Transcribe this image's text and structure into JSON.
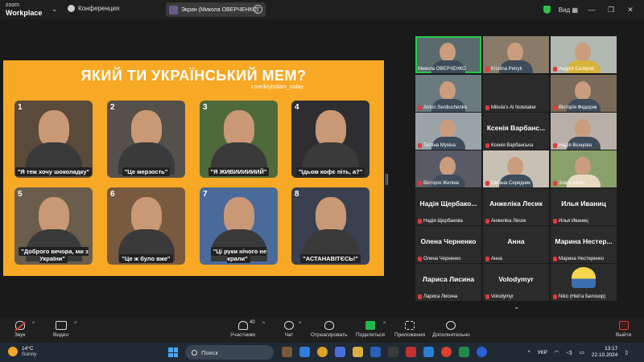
{
  "topbar": {
    "brand_top": "zoom",
    "brand_bottom": "Workplace",
    "meeting_title": "Конференция",
    "share_label": "Экран (Микола ОВЕРЧЕНКО)",
    "view_label": "Вид"
  },
  "shared_screen": {
    "title": "ЯКИЙ ТИ УКРАЇНСЬКИЙ МЕМ?",
    "link": "t.me/kryholam_today",
    "cards": [
      {
        "num": "1",
        "caption": "\"Я теж хочу шоколадку\""
      },
      {
        "num": "2",
        "caption": "\"Це мерзость\""
      },
      {
        "num": "3",
        "caption": "\"Я ЖИВИИИИИИЙ\""
      },
      {
        "num": "4",
        "caption": "\"Ідьом кофє піть, а?\""
      },
      {
        "num": "5",
        "caption": "\"Доброго вечора, ми з України\""
      },
      {
        "num": "6",
        "caption": "\"Це ж було вже\""
      },
      {
        "num": "7",
        "caption": "\"Ці руки нічого не крали\""
      },
      {
        "num": "8",
        "caption": "\"АСТАНАВІТЄСЬ!\""
      }
    ]
  },
  "gallery": {
    "tiles": [
      {
        "name": "Микола ОВЕРЧЕНКО",
        "big": ""
      },
      {
        "name": "Kristina Petryk",
        "big": ""
      },
      {
        "name": "Андрій Скляров",
        "big": ""
      },
      {
        "name": "Anton Serdiuchenko",
        "big": ""
      },
      {
        "name": "Mikola's AI Notetaker",
        "big": ""
      },
      {
        "name": "Вікторія Федорик",
        "big": ""
      },
      {
        "name": "Тетяна Мухіна",
        "big": ""
      },
      {
        "name": "Ксенія Варбанська",
        "big": "Ксенія Варбанс..."
      },
      {
        "name": "Надія Вєнцова",
        "big": ""
      },
      {
        "name": "Вікторія Жиліна",
        "big": ""
      },
      {
        "name": "Оксана Середняк",
        "big": ""
      },
      {
        "name": "Злата Мініч",
        "big": ""
      },
      {
        "name": "Надія Щербакова",
        "big": "Надія Щербако..."
      },
      {
        "name": "Анжеліка Лесик",
        "big": "Анжеліка Лесик"
      },
      {
        "name": "Илья Иваниц",
        "big": "Илья Иваниц"
      },
      {
        "name": "Олена Черненко",
        "big": "Олена Черненко"
      },
      {
        "name": "Анна",
        "big": "Анна"
      },
      {
        "name": "Марина Нестеренко",
        "big": "Марина Нестер..."
      },
      {
        "name": "Лариса Лисина",
        "big": "Лариса Лисина"
      },
      {
        "name": "Volodymyr",
        "big": "Volodymyr"
      },
      {
        "name": "Niko (Нікіта Белозор)",
        "big": ""
      }
    ]
  },
  "toolbar": {
    "audio": "Звук",
    "video": "Видео",
    "participants": "Участники",
    "participants_count": "40",
    "chat": "Чат",
    "react": "Отреагировать",
    "share": "Поделиться",
    "apps": "Приложения",
    "more": "Дополнительно",
    "leave": "Выйти"
  },
  "taskbar": {
    "temp": "14°C",
    "condition": "Sunny",
    "search_placeholder": "Поиск",
    "lang": "УКР",
    "time": "13:17",
    "date": "22.10.2024"
  },
  "colors": {
    "slide_bg": "#f7a824",
    "active_speaker": "#26c94a",
    "muted": "#e03a3a",
    "share_button": "#1fb84a"
  }
}
